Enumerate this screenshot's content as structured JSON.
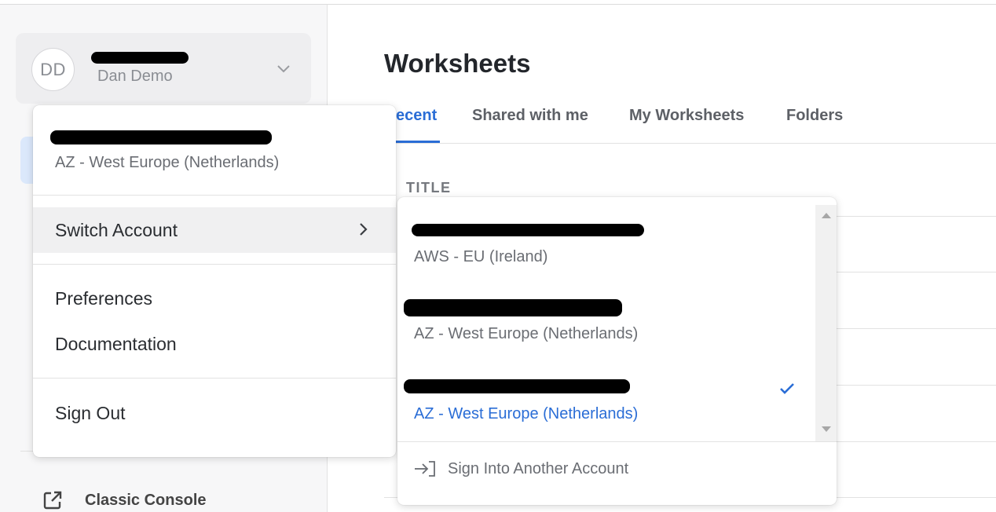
{
  "user": {
    "initials": "DD",
    "name": "Dan Demo"
  },
  "sidebar": {
    "classic_console_label": "Classic Console"
  },
  "main": {
    "title": "Worksheets",
    "tabs": [
      {
        "label": "ecent",
        "active": true
      },
      {
        "label": "Shared with me",
        "active": false
      },
      {
        "label": "My Worksheets",
        "active": false
      },
      {
        "label": "Folders",
        "active": false
      }
    ],
    "column_header": "TITLE"
  },
  "account_menu": {
    "current_region": "AZ - West Europe (Netherlands)",
    "items": {
      "switch_account": "Switch Account",
      "preferences": "Preferences",
      "documentation": "Documentation",
      "sign_out": "Sign Out"
    }
  },
  "switch_menu": {
    "accounts": [
      {
        "region": "AWS - EU (Ireland)",
        "selected": false
      },
      {
        "region": "AZ - West Europe (Netherlands)",
        "selected": false
      },
      {
        "region": "AZ - West Europe (Netherlands)",
        "selected": true
      }
    ],
    "sign_into_another": "Sign Into Another Account"
  },
  "colors": {
    "accent": "#2a6dd6",
    "redaction": "#000000"
  },
  "icons": {
    "user_chevron": "chevron-down-icon",
    "switch_chevron": "chevron-right-icon",
    "selected_check": "checkmark-icon",
    "sign_in": "sign-in-icon",
    "external": "external-link-icon"
  }
}
